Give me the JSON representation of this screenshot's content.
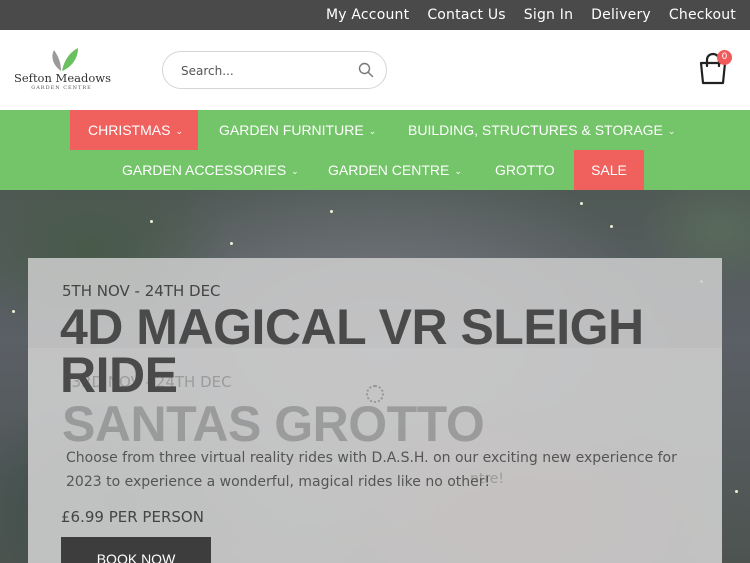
{
  "topbar": {
    "links": [
      "My Account",
      "Contact Us",
      "Sign In",
      "Delivery",
      "Checkout"
    ]
  },
  "brand": {
    "name": "Sefton Meadows",
    "tagline": "GARDEN CENTRE"
  },
  "search": {
    "placeholder": "Search..."
  },
  "cart": {
    "count": "0"
  },
  "nav": {
    "items": [
      {
        "label": "CHRISTMAS",
        "dropdown": true
      },
      {
        "label": "GARDEN FURNITURE",
        "dropdown": true
      },
      {
        "label": "BUILDING, STRUCTURES & STORAGE",
        "dropdown": true
      },
      {
        "label": "GARDEN ACCESSORIES",
        "dropdown": true
      },
      {
        "label": "GARDEN CENTRE",
        "dropdown": true
      },
      {
        "label": "GROTTO",
        "dropdown": false
      },
      {
        "label": "SALE",
        "dropdown": false
      }
    ],
    "chevron": "⌄"
  },
  "hero": {
    "dates": "5TH NOV - 24TH DEC",
    "title": "4D MAGICAL VR SLEIGH RIDE",
    "description": "Choose from three virtual reality rides with D.A.S.H. on our exciting new experience for 2023 to experience a wonderful, magical rides like no other!",
    "price": "£6.99 PER PERSON",
    "cta": "BOOK NOW",
    "next_slide": {
      "dates": "23RD NOV - 24TH DEC",
      "title": "SANTAS GROTTO",
      "description_fragment": "ntre!"
    }
  },
  "colors": {
    "topbar": "#4a4a4a",
    "nav": "#74c46a",
    "highlight": "#f0605d"
  }
}
